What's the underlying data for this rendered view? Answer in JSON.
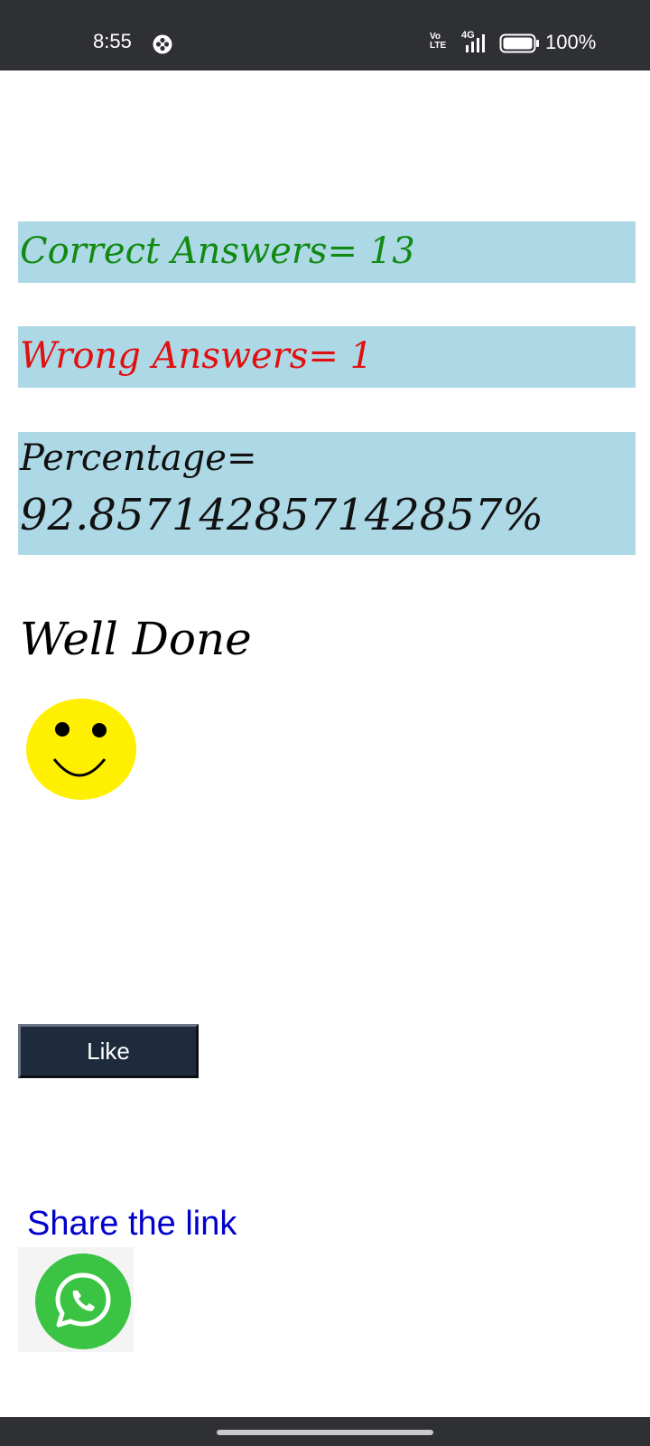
{
  "status_bar": {
    "time": "8:55",
    "app_icon": "game-controller-icon",
    "volte_line1": "Vo",
    "volte_line2": "LTE",
    "network": "4G",
    "signal_icon": "signal-bars-icon",
    "battery_icon": "battery-icon",
    "battery_level": 1.0,
    "battery_text": "100%"
  },
  "results": {
    "correct_text": "Correct Answers= 13",
    "wrong_text": "Wrong Answers= 1",
    "percentage_label": "Percentage=",
    "percentage_value": "92.857142857142857%"
  },
  "feedback": {
    "message": "Well Done",
    "emoji_icon": "smiley-face-icon"
  },
  "actions": {
    "like_label": "Like",
    "share_label": "Share the link",
    "share_icon": "whatsapp-icon"
  },
  "nav": {
    "handle_icon": "gesture-handle"
  },
  "colors": {
    "status_bar_bg": "#2f3034",
    "result_box_bg": "#add8e6",
    "correct_text": "#118a11",
    "wrong_text": "#e01010",
    "like_button_bg": "#1d2b3c",
    "share_link": "#0000cd",
    "whatsapp_green": "#3bc343",
    "smiley_yellow": "#ffef00"
  }
}
